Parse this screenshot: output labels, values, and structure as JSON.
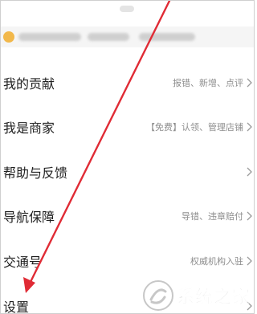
{
  "menu": {
    "items": [
      {
        "label": "我的贡献",
        "hint": "报错、新增、点评"
      },
      {
        "label": "我是商家",
        "hint": "【免费】认领、管理店铺"
      },
      {
        "label": "帮助与反馈",
        "hint": ""
      },
      {
        "label": "导航保障",
        "hint": "导错、违章赔付"
      },
      {
        "label": "交通号",
        "hint": "权威机构入驻"
      },
      {
        "label": "设置",
        "hint": ""
      }
    ]
  },
  "annotation": {
    "arrow_color": "#e02b35"
  },
  "banner": {
    "accent": "#f2b84b"
  },
  "watermark": {
    "text": "系统之家",
    "icon": "system-home-logo-icon"
  },
  "icons": {
    "chevron": "chevron-right-icon"
  }
}
